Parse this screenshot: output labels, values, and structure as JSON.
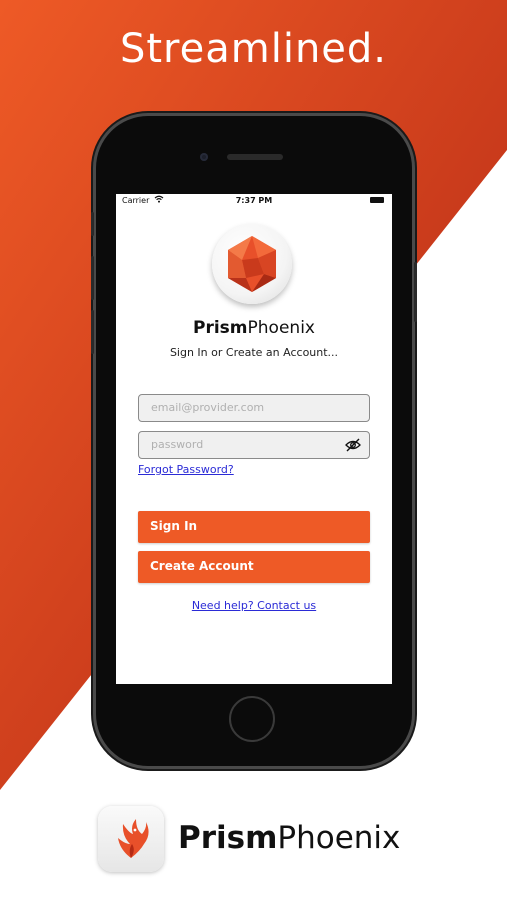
{
  "headline": "Streamlined.",
  "status_bar": {
    "carrier": "Carrier",
    "time": "7:37 PM"
  },
  "app": {
    "brand_bold": "Prism",
    "brand_light": "Phoenix",
    "subtitle": "Sign In or Create an Account..."
  },
  "form": {
    "email_placeholder": "email@provider.com",
    "password_placeholder": "password",
    "forgot_label": "Forgot Password?",
    "signin_label": "Sign In",
    "create_label": "Create Account",
    "help_label": "Need help? Contact us"
  },
  "footer": {
    "brand_bold": "Prism",
    "brand_light": "Phoenix"
  },
  "colors": {
    "accent": "#ee5a26",
    "background_red": "#c9341a",
    "link": "#2b2bd6"
  },
  "icons": [
    "wifi-icon",
    "battery-icon",
    "prism-logo",
    "eye-off-icon",
    "phoenix-app-icon"
  ]
}
